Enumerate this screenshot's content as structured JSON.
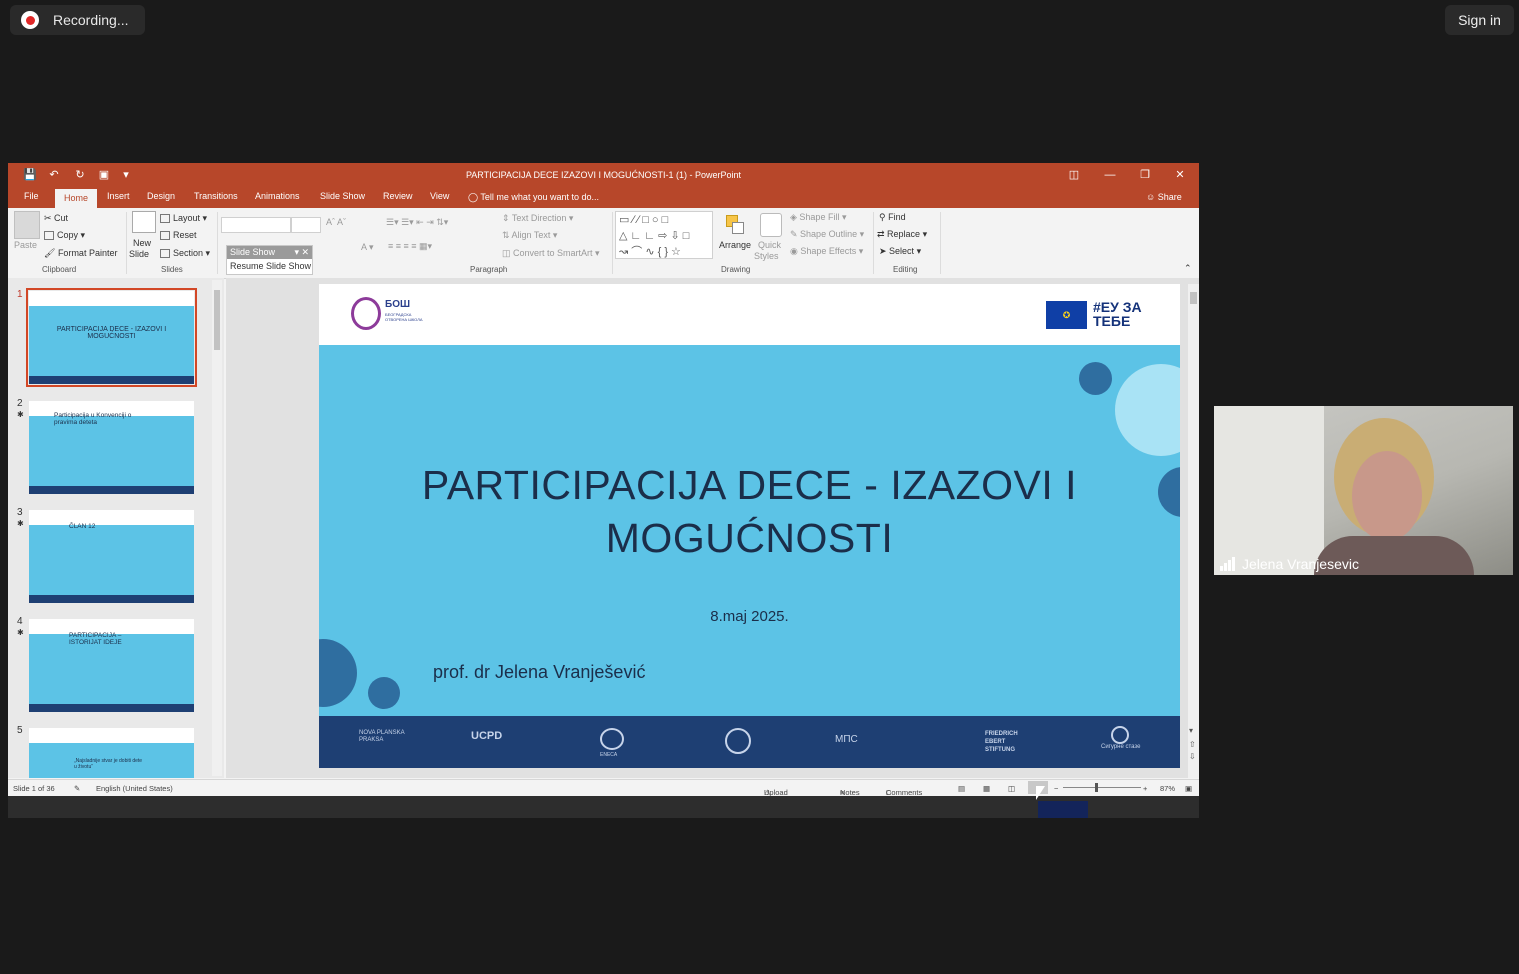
{
  "zoom": {
    "recording_label": "Recording...",
    "sign_in_label": "Sign in",
    "participant_name": "Jelena Vranjesevic"
  },
  "ppt": {
    "window_title": "PARTICIPACIJA DECE IZAZOVI I MOGUĆNOSTI-1 (1) - PowerPoint",
    "tabs": [
      "File",
      "Home",
      "Insert",
      "Design",
      "Transitions",
      "Animations",
      "Slide Show",
      "Review",
      "View"
    ],
    "tell_me": "Tell me what you want to do...",
    "share": "Share",
    "ribbon": {
      "clipboard": {
        "paste": "Paste",
        "cut": "Cut",
        "copy": "Copy",
        "format_painter": "Format Painter",
        "group": "Clipboard"
      },
      "slides": {
        "new_slide": "New",
        "new_slide_2": "Slide",
        "layout": "Layout",
        "reset": "Reset",
        "section": "Section",
        "group": "Slides"
      },
      "paragraph": {
        "text_direction": "Text Direction",
        "align_text": "Align Text",
        "convert_smartart": "Convert to SmartArt",
        "group": "Paragraph"
      },
      "drawing": {
        "arrange": "Arrange",
        "quick_styles": "Quick",
        "quick_styles_2": "Styles",
        "shape_fill": "Shape Fill",
        "shape_outline": "Shape Outline",
        "shape_effects": "Shape Effects",
        "group": "Drawing"
      },
      "editing": {
        "find": "Find",
        "replace": "Replace",
        "select": "Select",
        "group": "Editing"
      },
      "slideshow_popup": {
        "header": "Slide Show",
        "resume": "Resume Slide Show"
      }
    },
    "thumbnails": [
      {
        "num": "1",
        "title": "PARTICIPACIJA DECE  - IZAZOVI I MOGUĆNOSTI"
      },
      {
        "num": "2",
        "title": "Participacija u Konvenciji o pravima deteta"
      },
      {
        "num": "3",
        "title": "ČLAN 12"
      },
      {
        "num": "4",
        "title": "PARTICIPACIJA – ISTORIJAT IDEJE"
      },
      {
        "num": "5",
        "title": "„Najsladnije stvar je dobiti dete u životu“"
      }
    ],
    "slide": {
      "title": "PARTICIPACIJA DECE  - IZAZOVI I MOGUĆNOSTI",
      "date": "8.maj 2025.",
      "author": "prof. dr Jelena Vranješević",
      "logo_left": "БОШ",
      "logo_left_sub": "БЕОГРАДСКА ОТВОРЕНА ШКОЛА",
      "logo_right": "#ЕУ ЗА ТЕБЕ",
      "footer_logos": [
        "NOVA PLANSKA PRAKSA",
        "UCPD",
        "ENECA",
        "",
        "МПС",
        "FRIEDRICH EBERT STIFTUNG",
        "Сигурне стазе"
      ]
    },
    "status": {
      "slide_counter": "Slide 1 of 36",
      "language": "English (United States)",
      "upload": "Upload Failed",
      "notes": "Notes",
      "comments": "Comments",
      "zoom": "87%"
    }
  }
}
